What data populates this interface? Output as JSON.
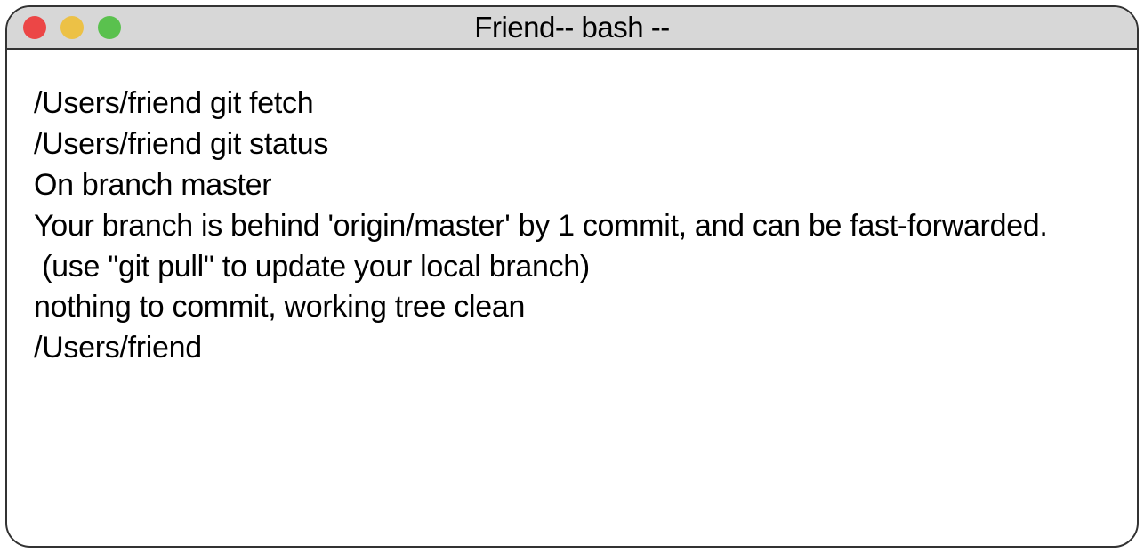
{
  "window": {
    "title": "Friend-- bash --"
  },
  "terminal": {
    "lines": [
      "/Users/friend git fetch",
      "/Users/friend git status",
      "On branch master",
      "Your branch is behind 'origin/master' by 1 commit, and can be fast-forwarded.",
      " (use \"git pull\" to update your local branch)",
      "",
      "nothing to commit, working tree clean",
      "/Users/friend"
    ]
  }
}
